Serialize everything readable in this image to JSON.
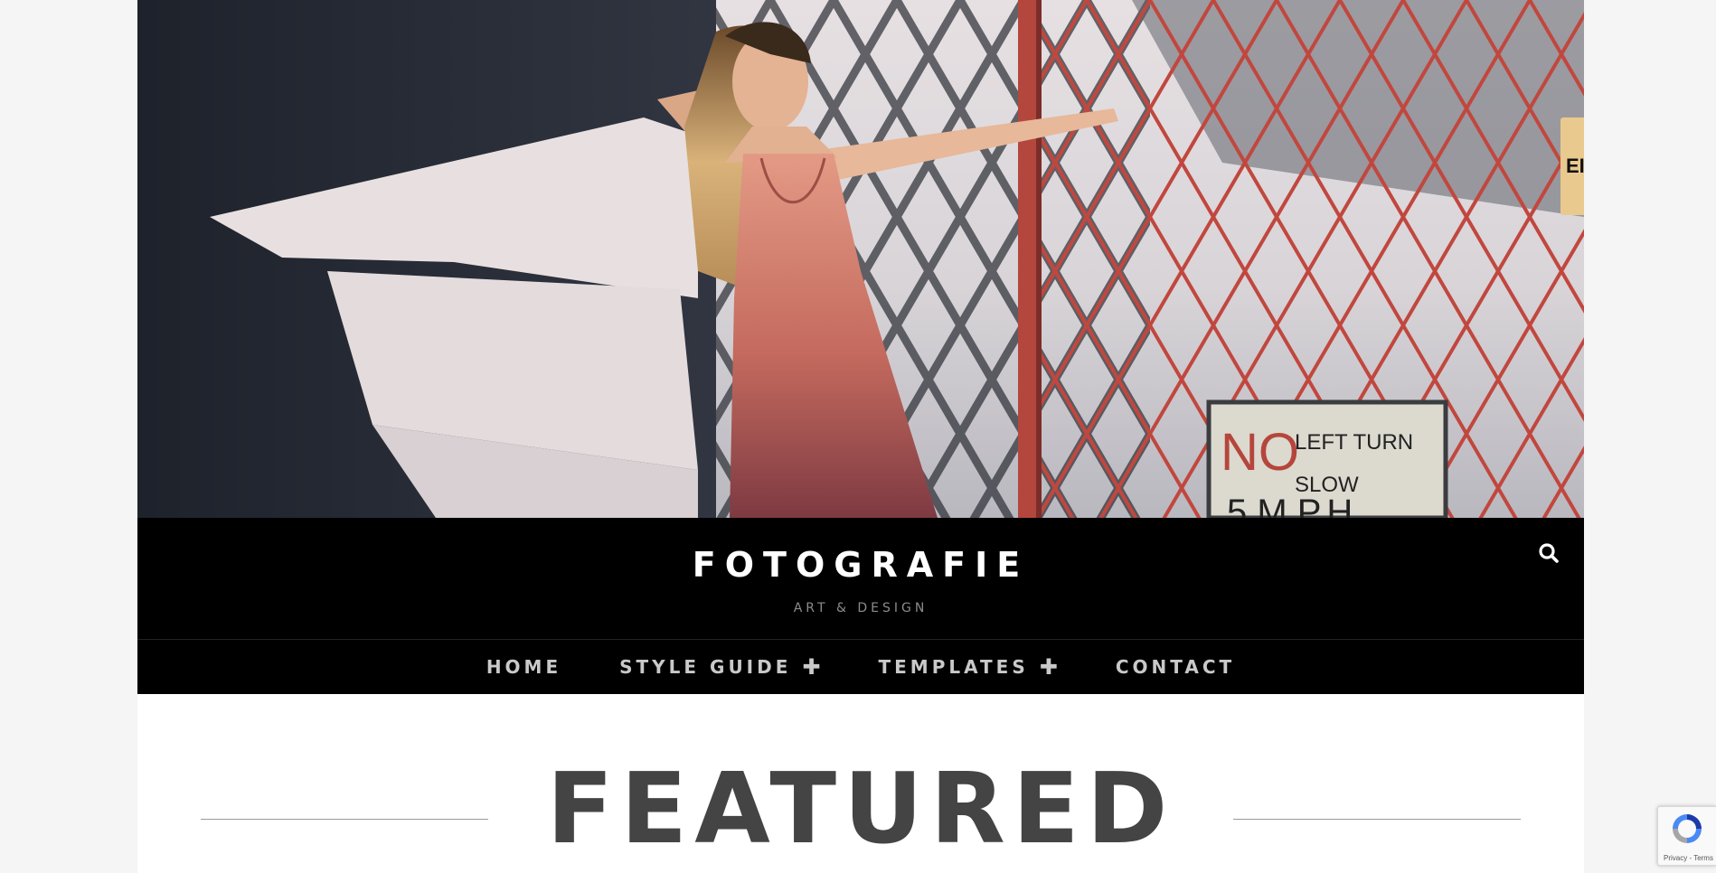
{
  "site": {
    "title": "FOTOGRAFIE",
    "tagline": "ART & DESIGN"
  },
  "hero": {
    "sign_line1": "NO",
    "sign_line2": "LEFT TURN",
    "sign_line3": "SLOW",
    "sign_line4": "5 M.P.H",
    "side_tab_text": "EI"
  },
  "nav": {
    "items": [
      {
        "label": "HOME",
        "has_submenu": false
      },
      {
        "label": "STYLE GUIDE",
        "has_submenu": true
      },
      {
        "label": "TEMPLATES",
        "has_submenu": true
      },
      {
        "label": "CONTACT",
        "has_submenu": false
      }
    ],
    "submenu_icon": "✚"
  },
  "featured": {
    "heading": "FEATURED"
  },
  "recaptcha": {
    "label": "Privacy - Terms"
  },
  "colors": {
    "page_bg": "#f5f5f5",
    "header_bg": "#000000",
    "nav_text": "#c9c9c9",
    "featured_text": "#444444"
  },
  "icons": {
    "search": "search-icon",
    "plus": "plus-icon",
    "recaptcha": "recaptcha-icon"
  }
}
